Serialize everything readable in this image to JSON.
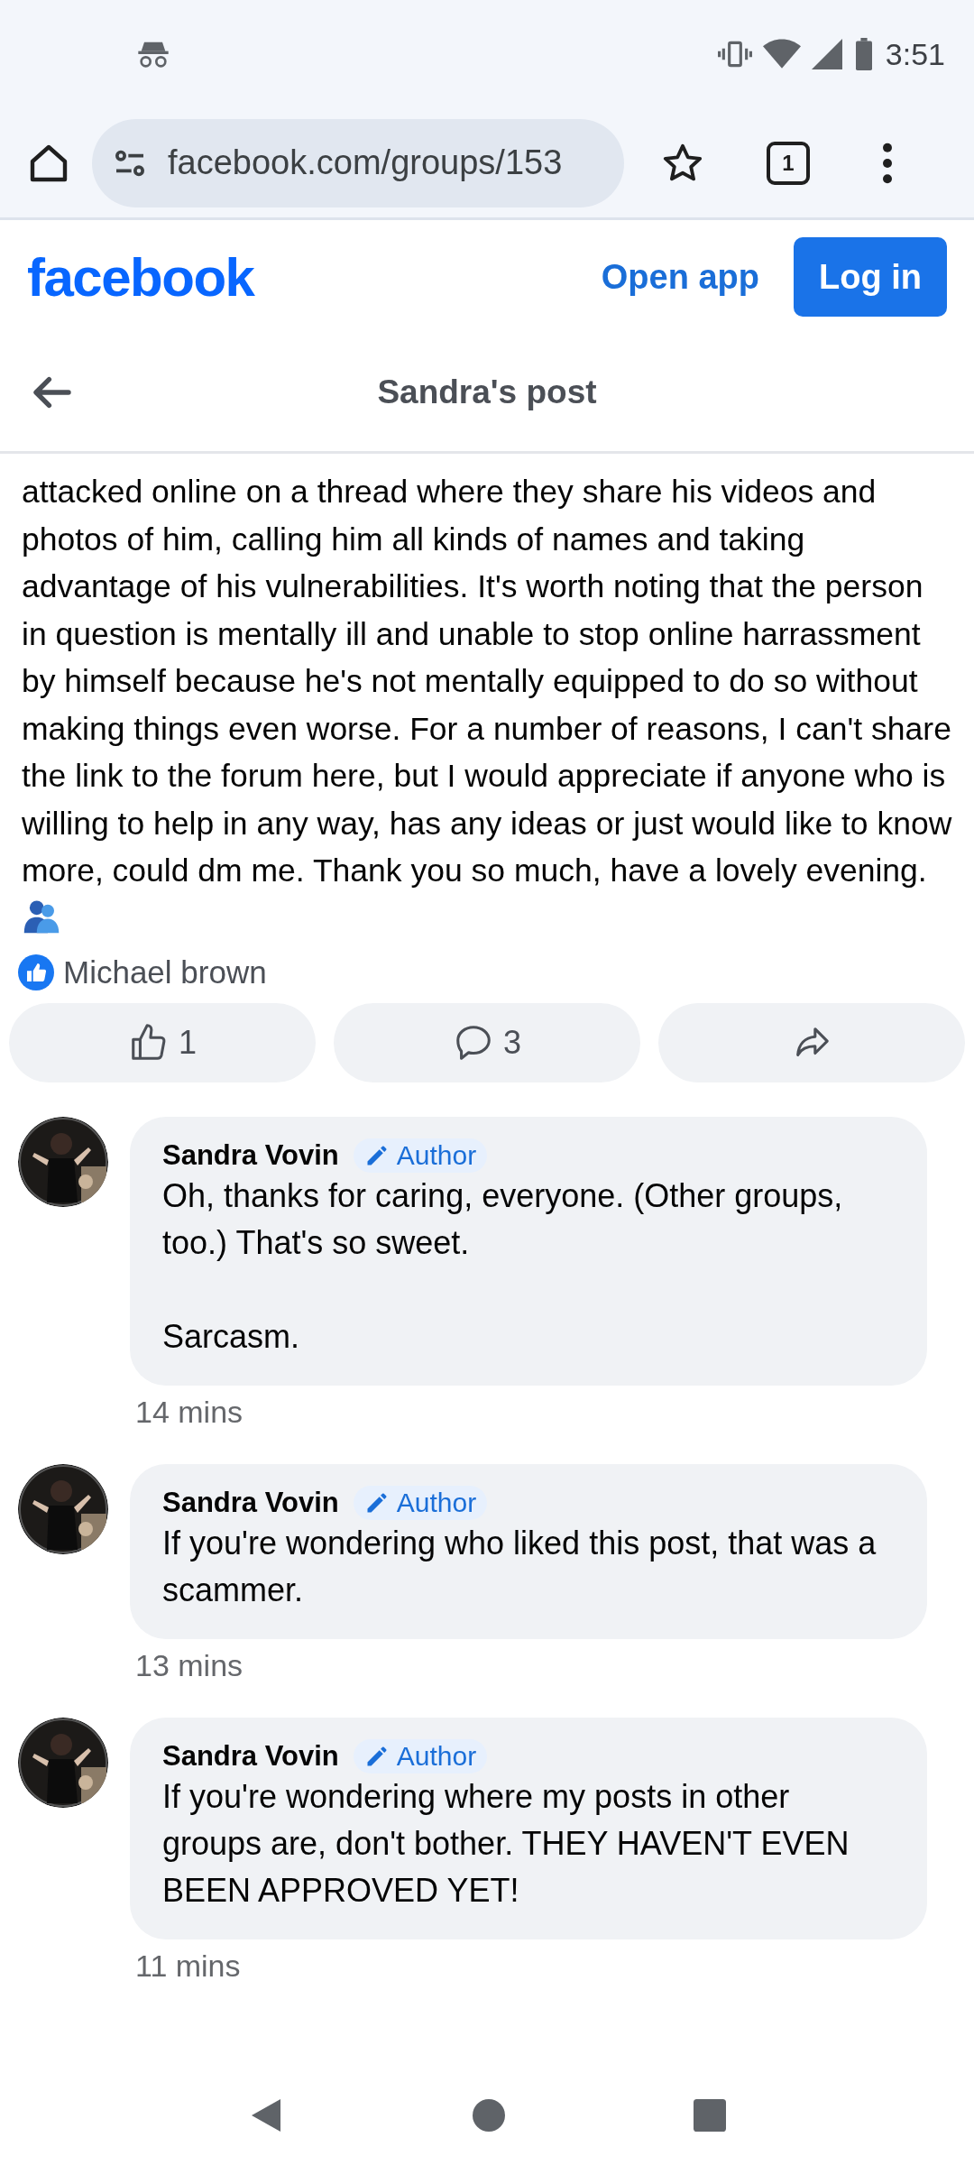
{
  "status_bar": {
    "time": "3:51"
  },
  "browser": {
    "url": "facebook.com/groups/153",
    "tab_count": "1"
  },
  "header": {
    "logo": "facebook",
    "open_app": "Open app",
    "login": "Log in"
  },
  "nav": {
    "title": "Sandra's post"
  },
  "post": {
    "text": "attacked online on a thread where they share his videos and photos of him, calling him all kinds of names and taking advantage of his vulnerabilities. It's worth noting that the person in question is mentally ill and unable to stop online harrassment by himself because he's not mentally equipped to do so without making things even worse. For a number of reasons, I can't share the link to the forum here, but I would appreciate if anyone who is willing to help in any way, has any ideas or just would like to know more, could dm me. Thank you so much, have a lovely evening.",
    "liked_by": "Michael brown",
    "actions": [
      {
        "kind": "like",
        "count": "1"
      },
      {
        "kind": "comment",
        "count": "3"
      },
      {
        "kind": "share"
      }
    ]
  },
  "comments": [
    {
      "name": "Sandra Vovin",
      "badge": "Author",
      "paragraphs": [
        "Oh, thanks for caring, everyone. (Other groups, too.) That's so sweet.",
        "Sarcasm."
      ],
      "time": "14 mins"
    },
    {
      "name": "Sandra Vovin",
      "badge": "Author",
      "paragraphs": [
        "If you're wondering who liked this post, that was a scammer."
      ],
      "time": "13 mins"
    },
    {
      "name": "Sandra Vovin",
      "badge": "Author",
      "paragraphs": [
        "If you're wondering where my posts in other groups are, don't bother. THEY HAVEN'T EVEN BEEN APPROVED YET!"
      ],
      "time": "11 mins"
    }
  ]
}
